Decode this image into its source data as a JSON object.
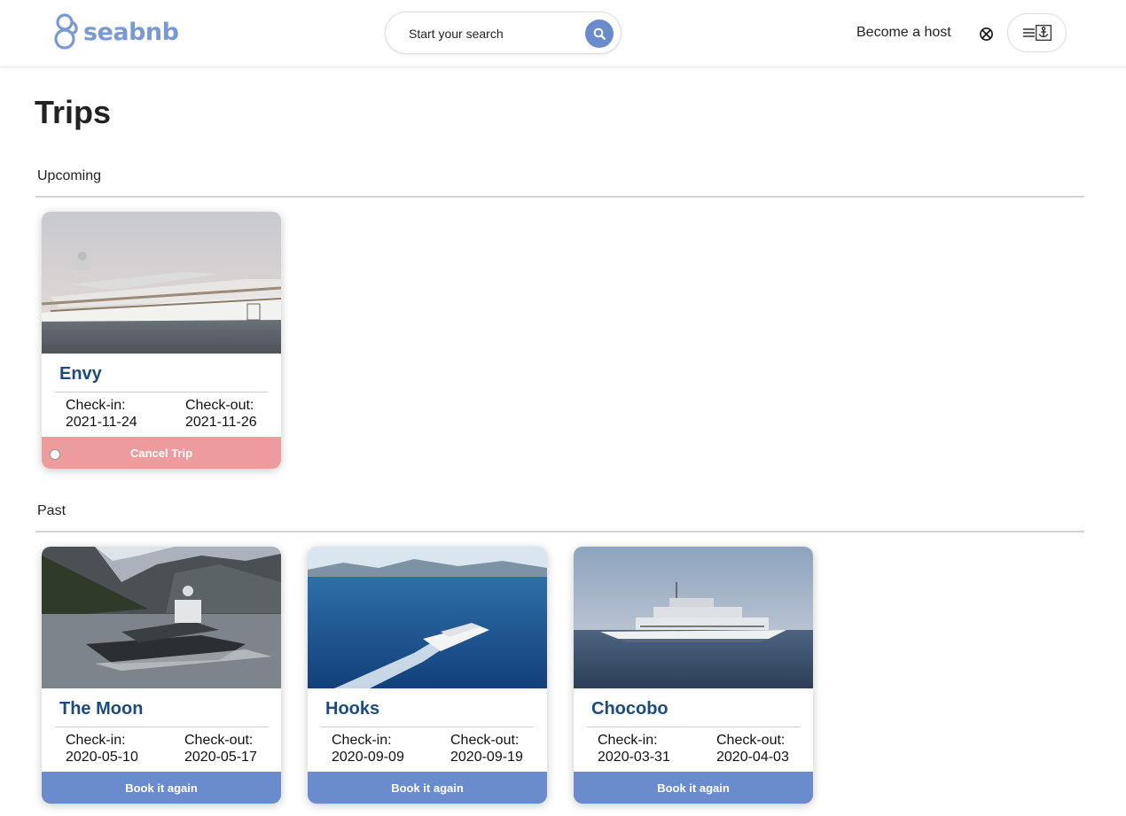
{
  "header": {
    "logo_text": "seabnb",
    "search_placeholder": "Start your search",
    "host_link": "Become a host",
    "icons": {
      "search": "search-icon",
      "globe": "globe-icon",
      "menu": "menu-icon",
      "anchor": "anchor-icon"
    },
    "colors": {
      "brand": "#7b99d1",
      "search_button": "#6b8ccc"
    }
  },
  "page": {
    "title": "Trips"
  },
  "upcoming": {
    "label": "Upcoming",
    "trips": [
      {
        "name": "Envy",
        "checkin_label": "Check-in:",
        "checkin": "2021-11-24",
        "checkout_label": "Check-out:",
        "checkout": "2021-11-26",
        "action": "Cancel Trip"
      }
    ]
  },
  "past": {
    "label": "Past",
    "trips": [
      {
        "name": "The Moon",
        "checkin_label": "Check-in:",
        "checkin": "2020-05-10",
        "checkout_label": "Check-out:",
        "checkout": "2020-05-17",
        "action": "Book it again"
      },
      {
        "name": "Hooks",
        "checkin_label": "Check-in:",
        "checkin": "2020-09-09",
        "checkout_label": "Check-out:",
        "checkout": "2020-09-19",
        "action": "Book it again"
      },
      {
        "name": "Chocobo",
        "checkin_label": "Check-in:",
        "checkin": "2020-03-31",
        "checkout_label": "Check-out:",
        "checkout": "2020-04-03",
        "action": "Book it again"
      }
    ]
  },
  "colors": {
    "cancel": "#ec9c9d",
    "book": "#6b8ccc",
    "title": "#1e4b7e"
  }
}
